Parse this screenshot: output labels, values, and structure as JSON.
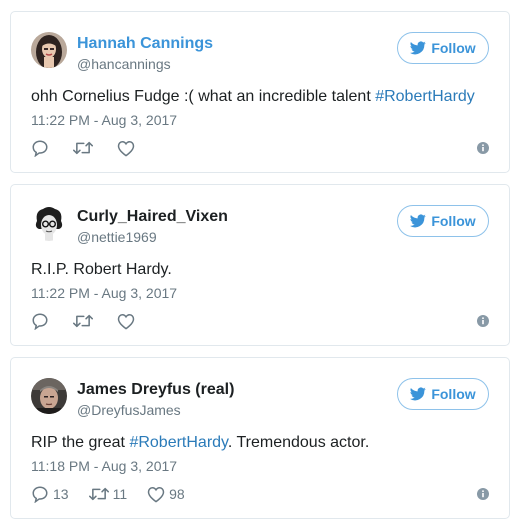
{
  "tweets": [
    {
      "author": "Hannah Cannings",
      "handle": "@hancannings",
      "follow_label": "Follow",
      "text": "ohh Cornelius Fudge :( what an incredible talent ",
      "hashtag": "#RobertHardy",
      "text_after": "",
      "timestamp": "11:22 PM - Aug 3, 2017",
      "replies": "",
      "retweets": "",
      "likes": ""
    },
    {
      "author": "Curly_Haired_Vixen",
      "handle": "@nettie1969",
      "follow_label": "Follow",
      "text": "R.I.P. Robert Hardy.",
      "hashtag": "",
      "text_after": "",
      "timestamp": "11:22 PM - Aug 3, 2017",
      "replies": "",
      "retweets": "",
      "likes": ""
    },
    {
      "author": "James Dreyfus (real)",
      "handle": "@DreyfusJames",
      "follow_label": "Follow",
      "text": "RIP the great ",
      "hashtag": "#RobertHardy",
      "text_after": ". Tremendous actor.",
      "timestamp": "11:18 PM - Aug 3, 2017",
      "replies": "13",
      "retweets": "11",
      "likes": "98"
    }
  ],
  "icons": {
    "follow": "twitter-bird-icon",
    "reply": "reply-icon",
    "retweet": "retweet-icon",
    "like": "heart-icon",
    "info": "info-icon"
  },
  "colors": {
    "accent": "#3b94d9",
    "hashtag": "#2b7bb9",
    "muted": "#697882",
    "border": "#e1e8ed"
  }
}
